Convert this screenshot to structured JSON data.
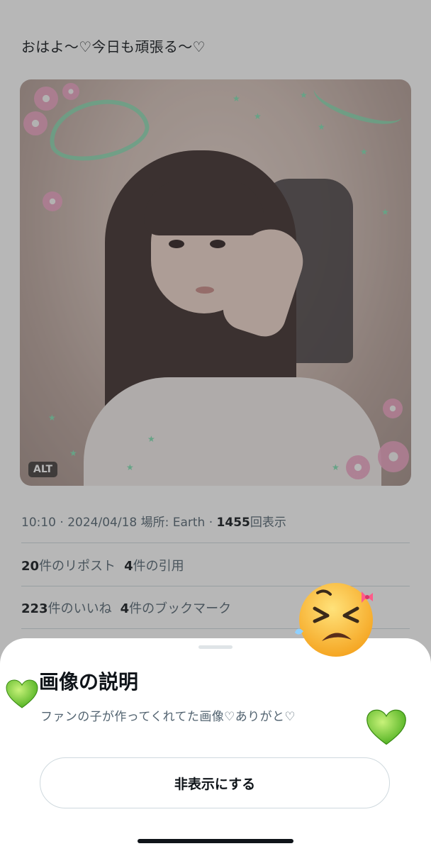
{
  "post": {
    "text": "おはよ〜♡今日も頑張る〜♡",
    "alt_badge": "ALT"
  },
  "meta": {
    "time": "10:10",
    "separator1": " · ",
    "date": "2024/04/18",
    "location": " 場所: Earth",
    "separator2": " · ",
    "views_count": "1455",
    "views_label": "回表示"
  },
  "stats_row1": {
    "reposts_count": "20",
    "reposts_label": "件のリポスト",
    "quotes_count": "4",
    "quotes_label": "件の引用"
  },
  "stats_row2": {
    "likes_count": "223",
    "likes_label": "件のいいね",
    "bookmarks_count": "4",
    "bookmarks_label": "件のブックマーク"
  },
  "sheet": {
    "title": "画像の説明",
    "description": "ファンの子が作ってくれてた画像♡ありがと♡",
    "hide_button": "非表示にする"
  },
  "colors": {
    "overlay": "#3c3c3c",
    "heart_green": "#7ed321",
    "emoji_yellow": "#ffcc33"
  },
  "icons": [
    "green-heart-icon",
    "green-heart-icon",
    "exhausted-face-emoji-icon"
  ]
}
